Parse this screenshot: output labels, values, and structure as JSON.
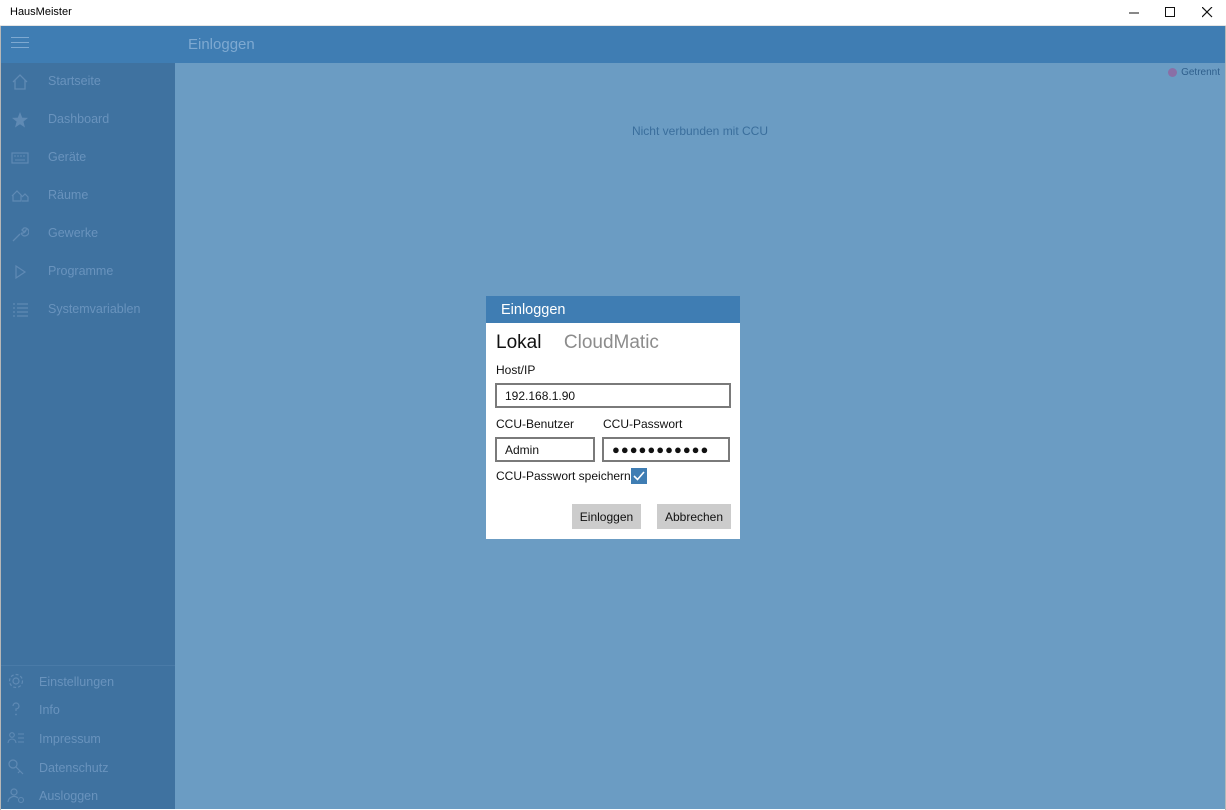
{
  "window": {
    "title": "HausMeister",
    "minimize": "–",
    "maximize": "☐",
    "close": "✕"
  },
  "header": {
    "title": "Einloggen"
  },
  "sidebar": {
    "items": [
      {
        "label": "Startseite",
        "icon": "home-icon"
      },
      {
        "label": "Dashboard",
        "icon": "star-icon"
      },
      {
        "label": "Geräte",
        "icon": "keyboard-icon"
      },
      {
        "label": "Räume",
        "icon": "rooms-icon"
      },
      {
        "label": "Gewerke",
        "icon": "wrench-icon"
      },
      {
        "label": "Programme",
        "icon": "play-icon"
      },
      {
        "label": "Systemvariablen",
        "icon": "list-icon"
      }
    ],
    "bottom_items": [
      {
        "label": "Einstellungen",
        "icon": "gear-icon"
      },
      {
        "label": "Info",
        "icon": "question-icon"
      },
      {
        "label": "Impressum",
        "icon": "contact-list-icon"
      },
      {
        "label": "Datenschutz",
        "icon": "key-icon"
      },
      {
        "label": "Ausloggen",
        "icon": "user-logout-icon"
      }
    ]
  },
  "main": {
    "status": "Getrennt",
    "message": "Nicht verbunden mit CCU"
  },
  "dialog": {
    "title": "Einloggen",
    "tabs": [
      {
        "label": "Lokal",
        "active": true
      },
      {
        "label": "CloudMatic",
        "active": false
      }
    ],
    "host_label": "Host/IP",
    "host_value": "192.168.1.90",
    "user_label": "CCU-Benutzer",
    "user_value": "Admin",
    "password_label": "CCU-Passwort",
    "password_value": "●●●●●●●●●●●",
    "save_password_label": "CCU-Passwort speichern",
    "save_password_checked": true,
    "login_button": "Einloggen",
    "cancel_button": "Abbrechen"
  },
  "colors": {
    "accent": "#3f7db3",
    "sidebar": "#3f72a0",
    "main_bg": "#6b9cc3",
    "status_dot": "#8a6fa6"
  }
}
